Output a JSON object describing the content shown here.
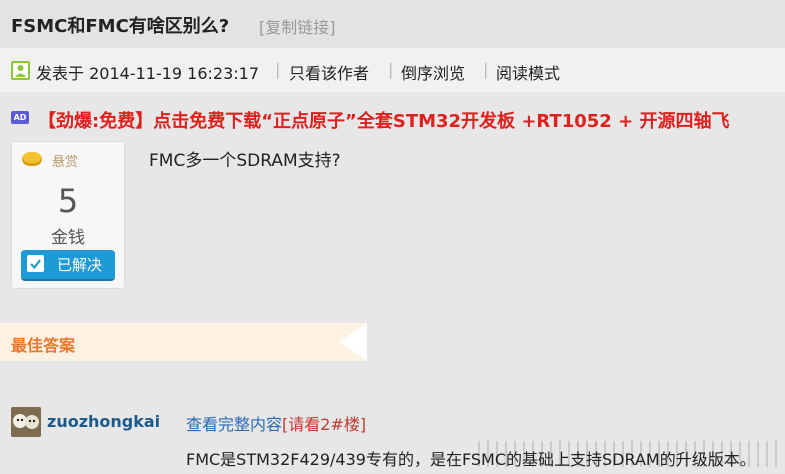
{
  "thread": {
    "title": "FSMC和FMC有啥区别么?",
    "copy_link": "[复制链接]"
  },
  "meta": {
    "posted_at": "发表于 2014-11-19 16:23:17",
    "author_only": "只看该作者",
    "reverse_order": "倒序浏览",
    "read_mode": "阅读模式"
  },
  "ad": {
    "badge": "AD",
    "text": "【劲爆:免费】点击免费下载“正点原子”全套STM32开发板 +RT1052 + 开源四轴飞"
  },
  "reward": {
    "label": "悬赏",
    "amount": "5",
    "unit": "金钱",
    "status": "已解决"
  },
  "question": {
    "text": "FMC多一个SDRAM支持?"
  },
  "best_answer": {
    "label": "最佳答案",
    "username": "zuozhongkai",
    "view_full": "查看完整内容",
    "view_hint": "[请看2#楼]",
    "text": "FMC是STM32F429/439专有的，是在FSMC的基础上支持SDRAM的升级版本。"
  },
  "colors": {
    "ad_red": "#e0201e",
    "solved_blue": "#1e9bd7",
    "best_answer_orange": "#e8792e",
    "link_blue": "#2a6ab3"
  }
}
